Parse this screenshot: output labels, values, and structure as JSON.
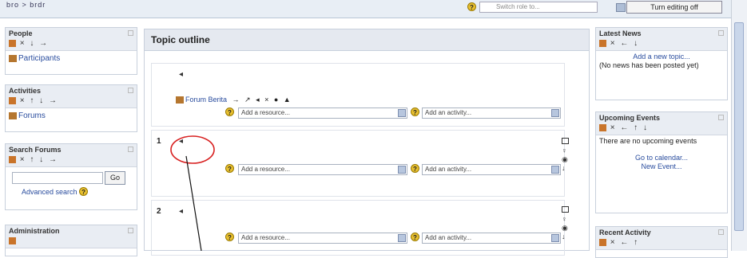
{
  "topbar": {
    "breadcrumb": "bro > brdr",
    "switch_role": "Switch role to...",
    "turn_editing": "Turn editing off"
  },
  "left": {
    "people": {
      "title": "People",
      "icons": "× ↓ →",
      "participants": "Participants"
    },
    "activities": {
      "title": "Activities",
      "icons": "× ↑ ↓ →",
      "forums": "Forums"
    },
    "search": {
      "title": "Search Forums",
      "icons": "× ↑ ↓ →",
      "go": "Go",
      "advanced": "Advanced search"
    },
    "admin": {
      "title": "Administration"
    }
  },
  "main": {
    "title": "Topic outline",
    "section0": {
      "forum_link": "Forum Berita",
      "forum_icons": "→ ↗ ◂ × ● ▲",
      "add_resource": "Add a resource...",
      "add_activity": "Add an activity..."
    },
    "section1": {
      "number": "1",
      "add_resource": "Add a resource...",
      "add_activity": "Add an activity..."
    },
    "section2": {
      "number": "2",
      "add_resource": "Add a resource...",
      "add_activity": "Add an activity..."
    }
  },
  "right": {
    "latest_news": {
      "title": "Latest News",
      "icons": "× ← ↓",
      "add_topic": "Add a new topic...",
      "empty": "(No news has been posted yet)"
    },
    "upcoming": {
      "title": "Upcoming Events",
      "icons": "× ← ↑ ↓",
      "empty": "There are no upcoming events",
      "goto_calendar": "Go to calendar...",
      "new_event": "New Event..."
    },
    "recent": {
      "title": "Recent Activity",
      "icons": "× ← ↑"
    }
  },
  "colors": {
    "annotation": "#d82020",
    "link": "#2a4d9e",
    "header_bg": "#e9edf3"
  }
}
